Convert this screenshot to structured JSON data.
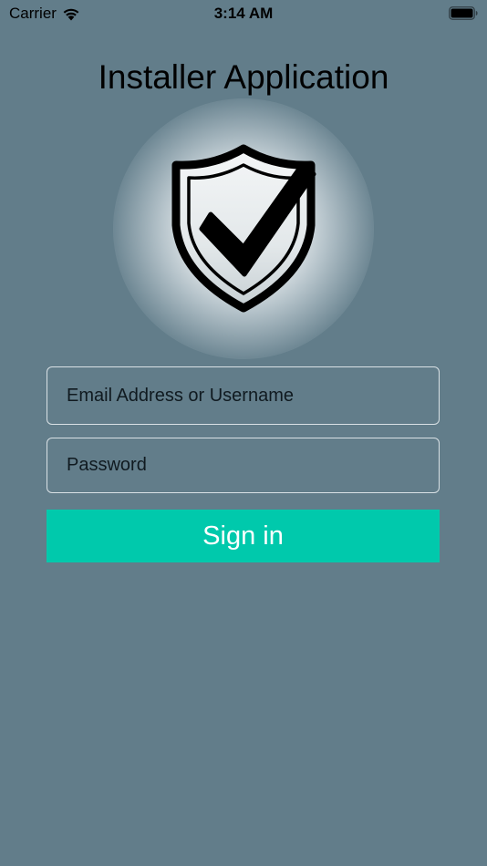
{
  "status_bar": {
    "carrier": "Carrier",
    "time": "3:14 AM",
    "icons": [
      "wifi-icon",
      "battery-icon"
    ]
  },
  "app": {
    "title": "Installer Application",
    "logo_icon": "shield-check-icon"
  },
  "login_form": {
    "email_placeholder": "Email Address or Username",
    "email_value": "",
    "password_placeholder": "Password",
    "password_value": "",
    "sign_in_label": "Sign in"
  },
  "colors": {
    "background": "#627d8a",
    "accent": "#00c9ac",
    "field_border": "#d9e1e5"
  }
}
